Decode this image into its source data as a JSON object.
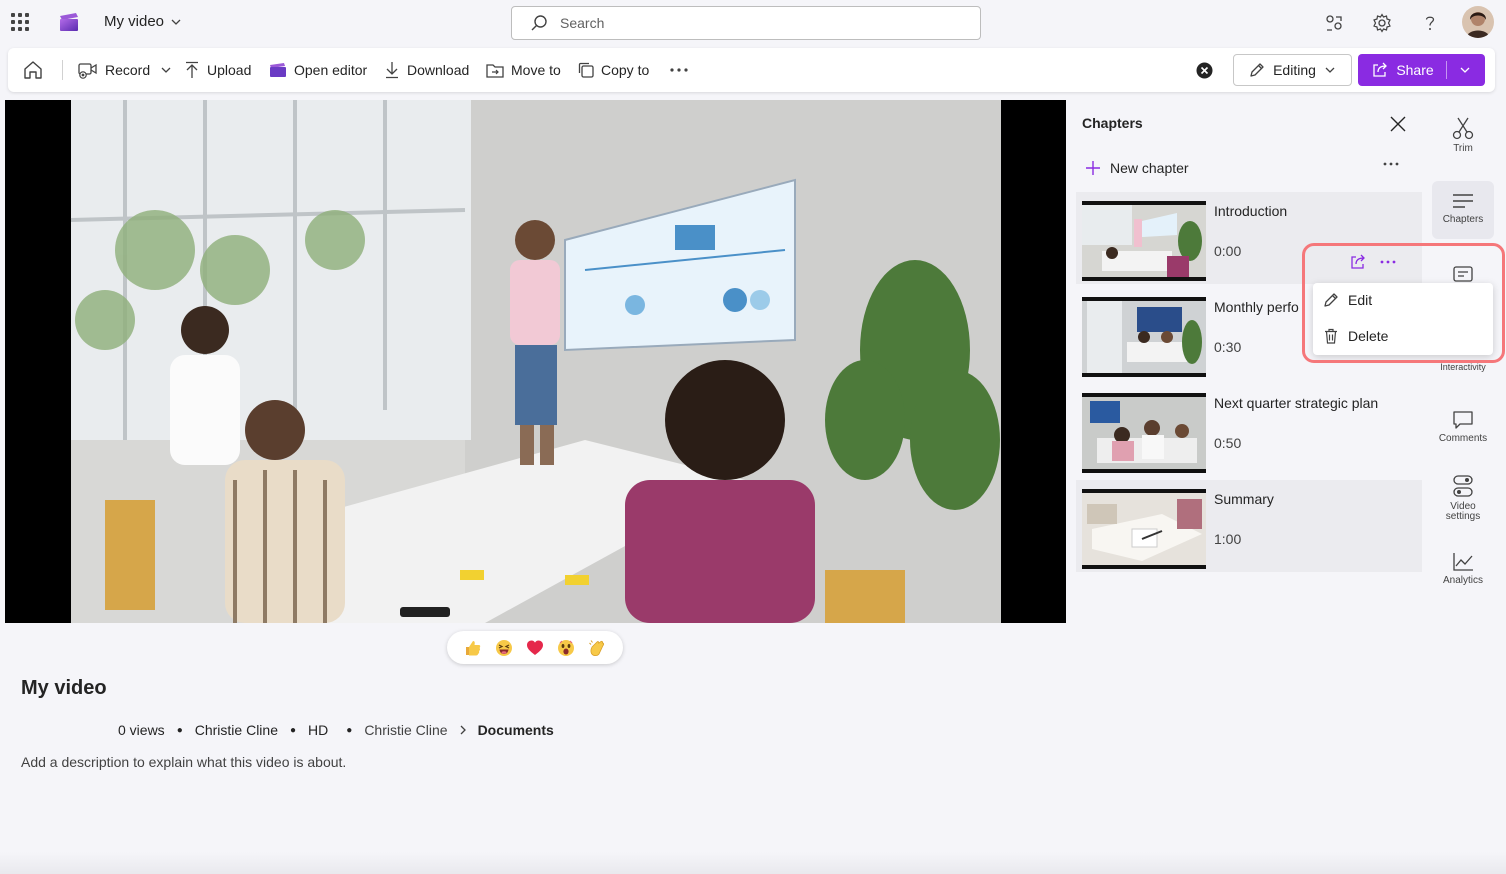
{
  "app": {
    "title": "My video",
    "search_placeholder": "Search"
  },
  "toolbar": {
    "record_label": "Record",
    "upload_label": "Upload",
    "open_editor_label": "Open editor",
    "download_label": "Download",
    "move_to_label": "Move to",
    "copy_to_label": "Copy to",
    "editing_label": "Editing",
    "share_label": "Share"
  },
  "video": {
    "title": "My video",
    "views": "0 views",
    "owner": "Christie Cline",
    "quality": "HD",
    "breadcrumb": [
      "Christie Cline",
      "Documents"
    ],
    "description_placeholder": "Add a description to explain what this video is about.",
    "reactions": [
      "thumbs-up-emoji",
      "laughing-emoji",
      "heart-emoji",
      "surprised-emoji",
      "clap-emoji"
    ]
  },
  "chapters": {
    "title": "Chapters",
    "new_chapter_label": "New chapter",
    "items": [
      {
        "name": "Introduction",
        "time": "0:00"
      },
      {
        "name": "Monthly perfo",
        "time": "0:30"
      },
      {
        "name": "Next quarter strategic plan",
        "time": "0:50"
      },
      {
        "name": "Summary",
        "time": "1:00"
      }
    ],
    "context_menu": {
      "edit_label": "Edit",
      "delete_label": "Delete"
    }
  },
  "rail": {
    "trim": "Trim",
    "chapters": "Chapters",
    "interactivity": "Interactivity",
    "comments": "Comments",
    "video_settings_line1": "Video",
    "video_settings_line2": "settings",
    "analytics": "Analytics"
  },
  "colors": {
    "accent": "#8a2be2",
    "highlight": "#f5777a",
    "background": "#f5f5f9"
  }
}
